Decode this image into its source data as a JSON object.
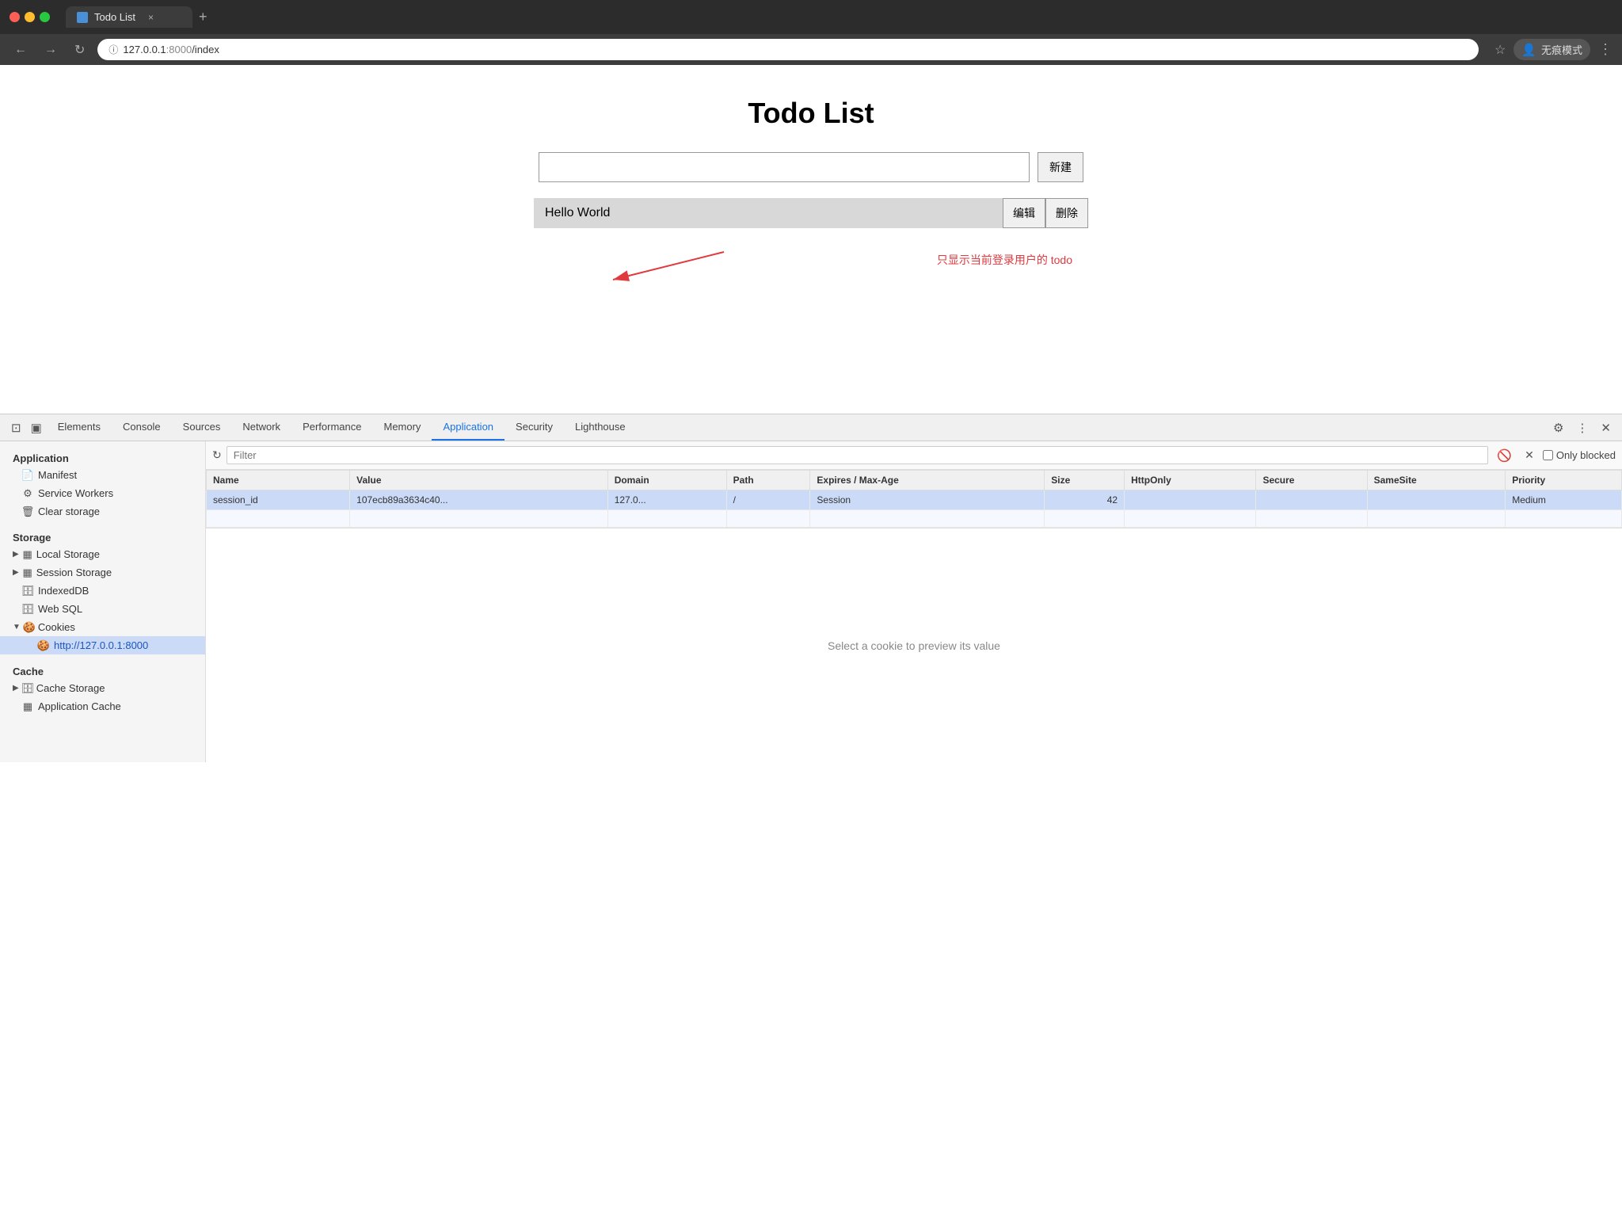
{
  "browser": {
    "tab_favicon_color": "#4a90d9",
    "tab_title": "Todo List",
    "tab_close": "×",
    "tab_new": "+",
    "nav_back": "←",
    "nav_forward": "→",
    "nav_refresh": "↻",
    "address_protocol": "127.0.0.1",
    "address_port": ":8000",
    "address_path": "/index",
    "star_label": "☆",
    "incognito_label": "无痕模式",
    "more_label": "⋮"
  },
  "page": {
    "title": "Todo List",
    "input_placeholder": "",
    "btn_create": "新建",
    "todo_item_text": "Hello World",
    "btn_edit": "编辑",
    "btn_delete": "删除",
    "annotation": "只显示当前登录用户的 todo"
  },
  "devtools": {
    "tabs": [
      {
        "label": "Elements",
        "active": false
      },
      {
        "label": "Console",
        "active": false
      },
      {
        "label": "Sources",
        "active": false
      },
      {
        "label": "Network",
        "active": false
      },
      {
        "label": "Performance",
        "active": false
      },
      {
        "label": "Memory",
        "active": false
      },
      {
        "label": "Application",
        "active": true
      },
      {
        "label": "Security",
        "active": false
      },
      {
        "label": "Lighthouse",
        "active": false
      }
    ],
    "settings_icon": "⚙",
    "more_icon": "⋮",
    "close_icon": "✕",
    "cursor_icon": "⊡",
    "device_icon": "▣",
    "sidebar": {
      "section_application": "Application",
      "manifest_label": "Manifest",
      "service_workers_label": "Service Workers",
      "clear_storage_label": "Clear storage",
      "section_storage": "Storage",
      "local_storage_label": "Local Storage",
      "session_storage_label": "Session Storage",
      "indexeddb_label": "IndexedDB",
      "websql_label": "Web SQL",
      "cookies_label": "Cookies",
      "cookies_child_label": "http://127.0.0.1:8000",
      "section_cache": "Cache",
      "cache_storage_label": "Cache Storage",
      "app_cache_label": "Application Cache"
    },
    "filter": {
      "placeholder": "Filter",
      "refresh_icon": "↻",
      "block_icon": "🚫",
      "clear_icon": "✕",
      "only_blocked_label": "Only blocked"
    },
    "table": {
      "columns": [
        "Name",
        "Value",
        "Domain",
        "Path",
        "Expires / Max-Age",
        "Size",
        "HttpOnly",
        "Secure",
        "SameSite",
        "Priority"
      ],
      "rows": [
        {
          "name": "session_id",
          "value": "107ecb89a3634c40...",
          "domain": "127.0...",
          "path": "/",
          "expires": "Session",
          "size": "42",
          "httponly": "",
          "secure": "",
          "samesite": "",
          "priority": "Medium"
        }
      ]
    },
    "preview_text": "Select a cookie to preview its value"
  }
}
